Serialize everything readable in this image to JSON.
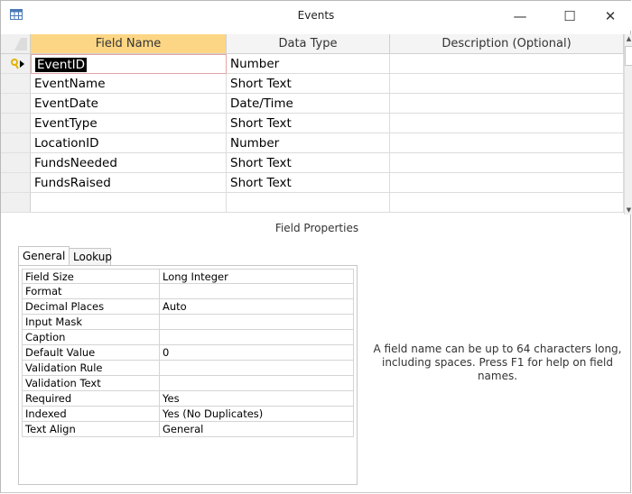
{
  "window": {
    "title": "Events",
    "minimize": "—",
    "maximize": "☐",
    "close": "✕"
  },
  "grid": {
    "headers": [
      "Field Name",
      "Data Type",
      "Description (Optional)"
    ],
    "rows": [
      {
        "name": "EventID",
        "type": "Number",
        "description": ""
      },
      {
        "name": "EventName",
        "type": "Short Text",
        "description": ""
      },
      {
        "name": "EventDate",
        "type": "Date/Time",
        "description": ""
      },
      {
        "name": "EventType",
        "type": "Short Text",
        "description": ""
      },
      {
        "name": "LocationID",
        "type": "Number",
        "description": ""
      },
      {
        "name": "FundsNeeded",
        "type": "Short Text",
        "description": ""
      },
      {
        "name": "FundsRaised",
        "type": "Short Text",
        "description": ""
      },
      {
        "name": "",
        "type": "",
        "description": ""
      }
    ]
  },
  "field_properties": {
    "caption": "Field Properties",
    "tabs": [
      "General",
      "Lookup"
    ],
    "rows": [
      {
        "label": "Field Size",
        "value": "Long Integer"
      },
      {
        "label": "Format",
        "value": ""
      },
      {
        "label": "Decimal Places",
        "value": "Auto"
      },
      {
        "label": "Input Mask",
        "value": ""
      },
      {
        "label": "Caption",
        "value": ""
      },
      {
        "label": "Default Value",
        "value": "0"
      },
      {
        "label": "Validation Rule",
        "value": ""
      },
      {
        "label": "Validation Text",
        "value": ""
      },
      {
        "label": "Required",
        "value": "Yes"
      },
      {
        "label": "Indexed",
        "value": "Yes (No Duplicates)"
      },
      {
        "label": "Text Align",
        "value": "General"
      }
    ],
    "help_text": "A field name can be up to 64 characters long, including spaces. Press F1 for help on field names."
  },
  "colors": {
    "active_header": "#fcd684",
    "selection": "#000000",
    "key_icon": "#e3b300"
  }
}
